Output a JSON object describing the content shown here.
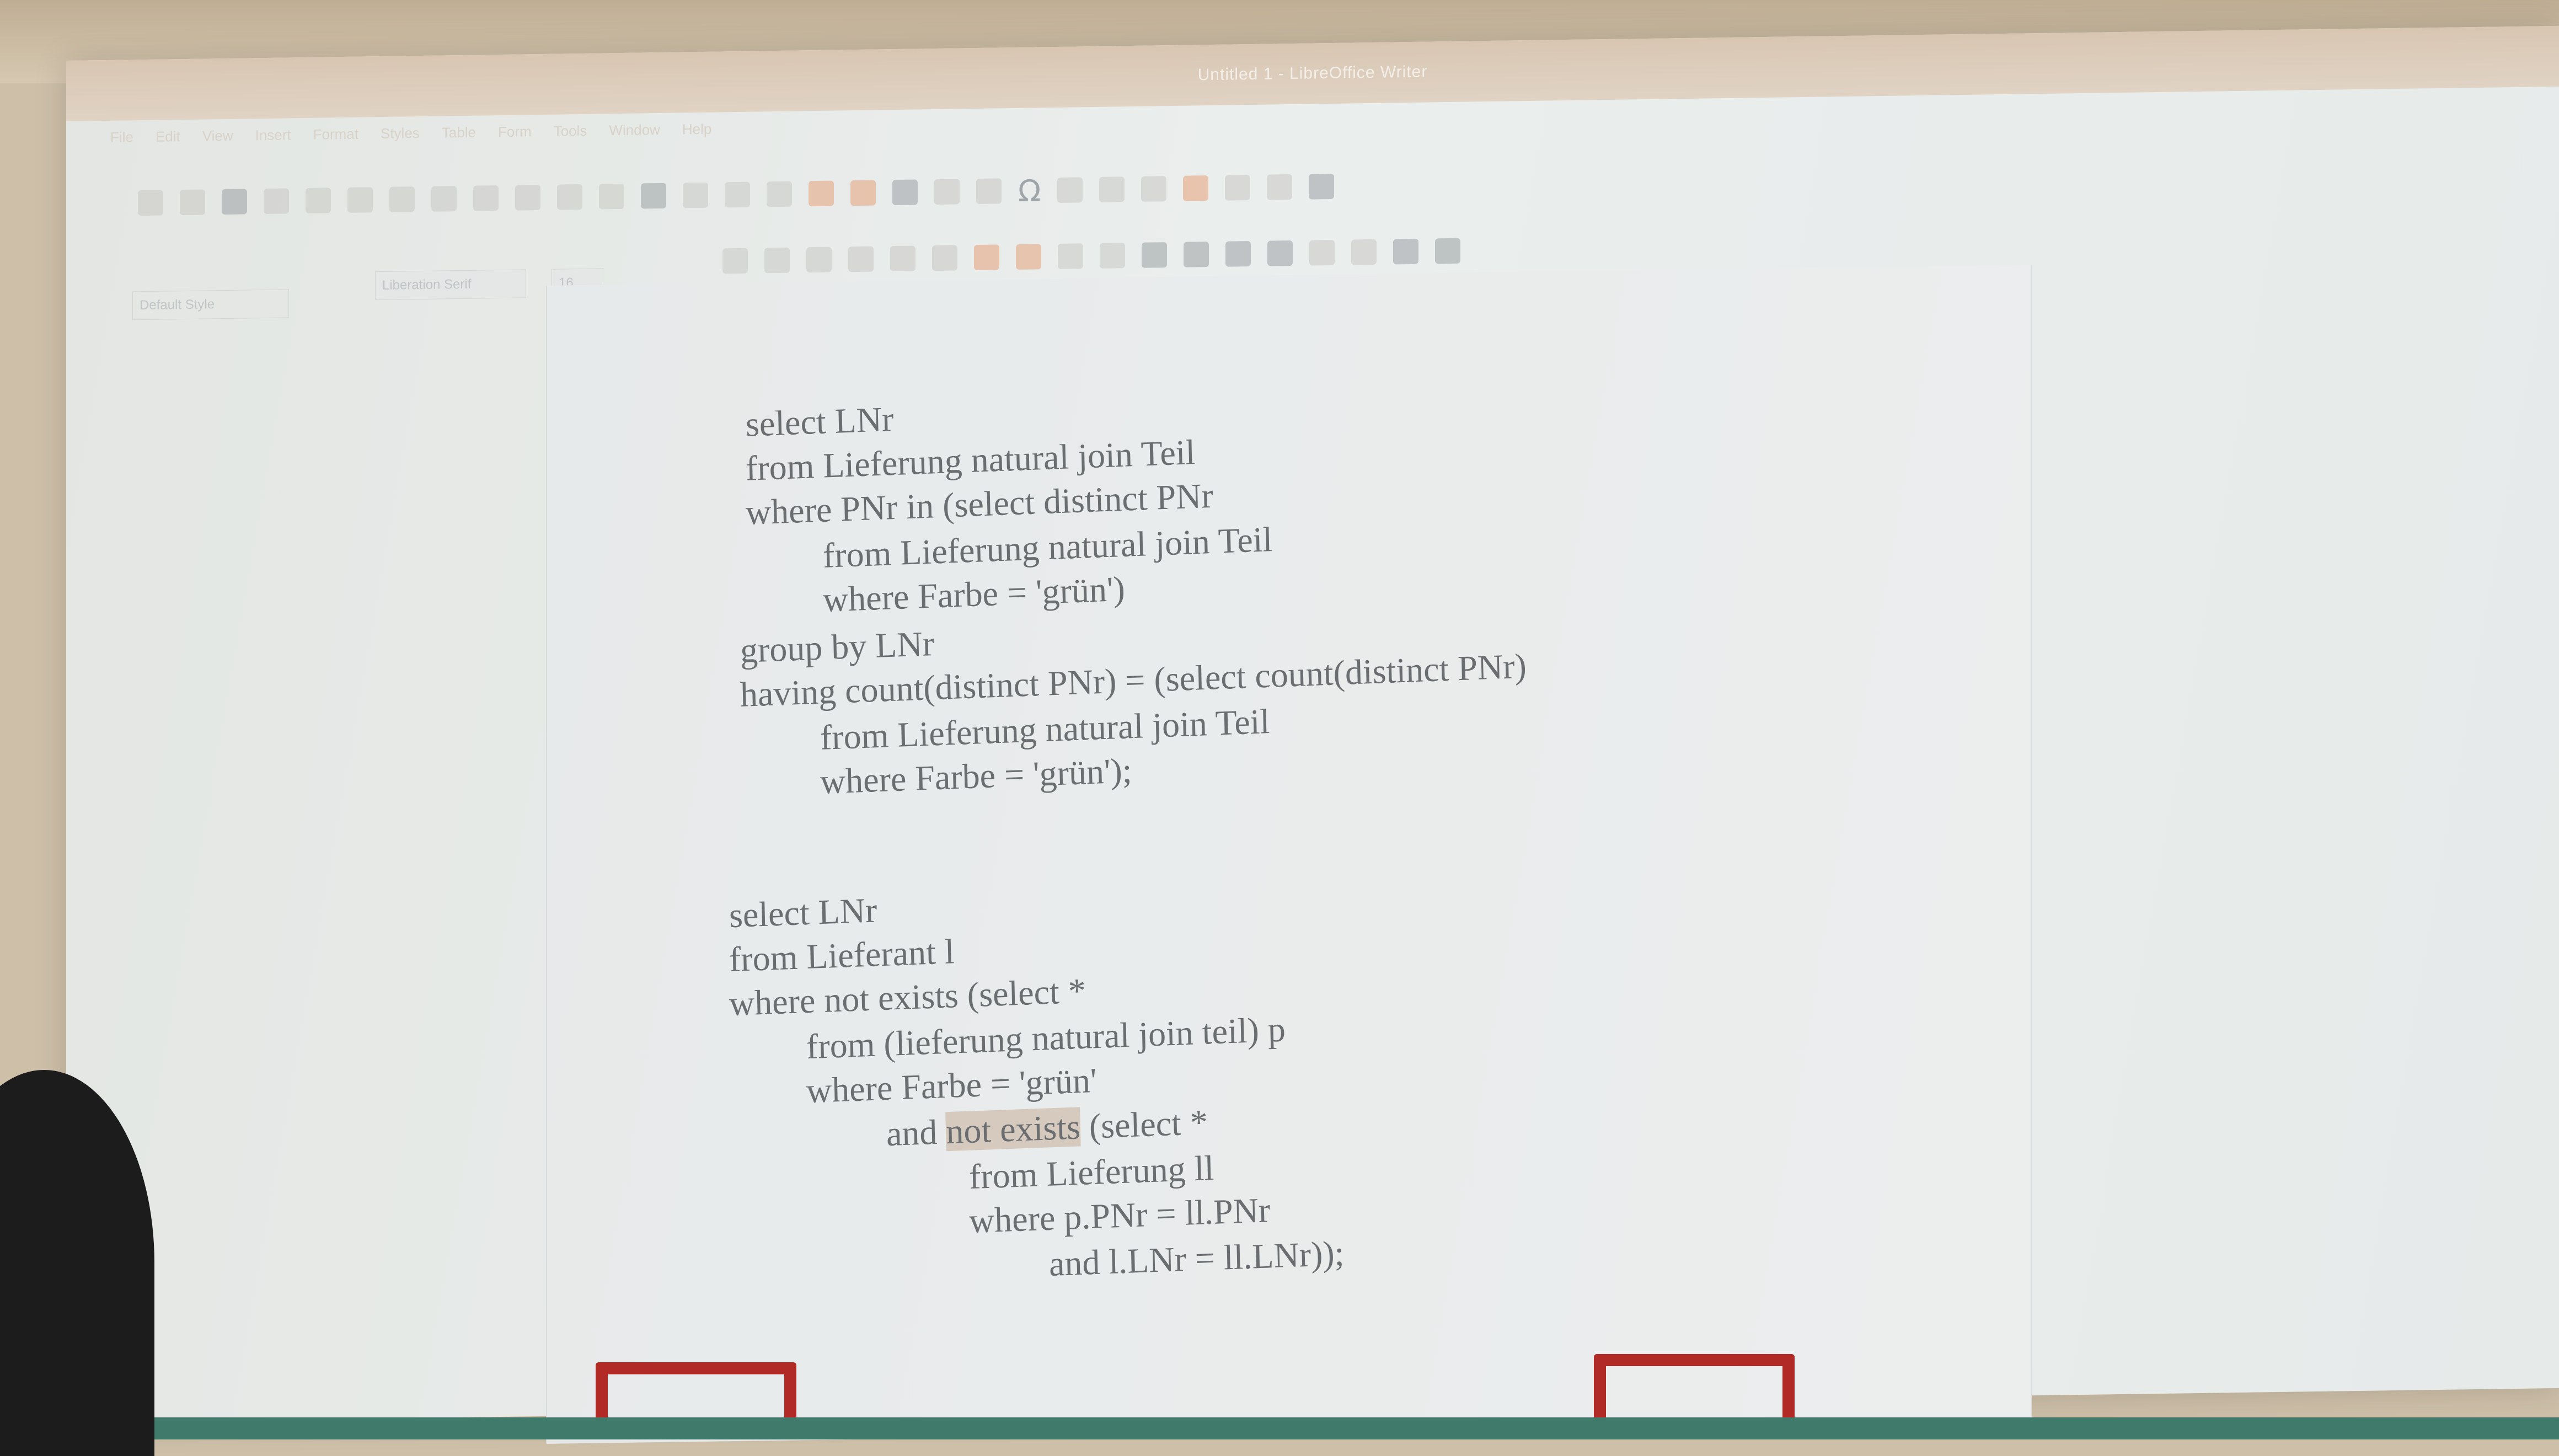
{
  "window": {
    "title": "Untitled 1 - LibreOffice Writer"
  },
  "menubar": {
    "items": [
      "File",
      "Edit",
      "View",
      "Insert",
      "Format",
      "Styles",
      "Table",
      "Form",
      "Tools",
      "Window",
      "Help"
    ]
  },
  "toolbar": {
    "paragraph_style": "Default Style",
    "font_name": "Liberation Serif",
    "font_size": "16",
    "special_char_icon": "Ω"
  },
  "document": {
    "query1": {
      "l1": "select LNr",
      "l2": "from Lieferung natural join Teil",
      "l3": "where PNr in (select distinct PNr",
      "l4": "from Lieferung natural join Teil",
      "l5": "where Farbe = 'grün')",
      "l6": "group by LNr",
      "l7": "having count(distinct PNr) = (select count(distinct PNr)",
      "l8": "from Lieferung natural join Teil",
      "l9": "where Farbe = 'grün');"
    },
    "query2": {
      "l1": "select LNr",
      "l2": "from Lieferant l",
      "l3": "where not exists (select *",
      "l4": "from (lieferung natural join teil) p",
      "l5": "where Farbe = 'grün'",
      "l6a": "and ",
      "l6b": "not exists",
      "l6c": " (select *",
      "l7": "from Lieferung ll",
      "l8": "where p.PNr = ll.PNr",
      "l9": "and l.LNr = ll.LNr));"
    }
  },
  "colors": {
    "accent": "#b22a26",
    "text": "#6a6e70",
    "floor": "#3f7a6b"
  }
}
